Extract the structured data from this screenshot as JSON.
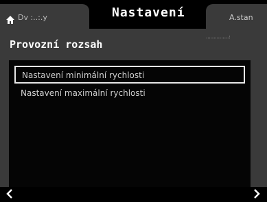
{
  "tabs": {
    "prev_label": "Dv  :..:.y",
    "title": "Nastavení",
    "next_label": "A.stan"
  },
  "section": {
    "title": "Provozní rozsah",
    "subtitle": "...............:"
  },
  "list": {
    "items": [
      {
        "label": "Nastavení minimální rychlosti"
      },
      {
        "label": "Nastavení maximální rychlosti"
      }
    ]
  },
  "icons": {
    "home": "home-icon",
    "left": "chevron-left-icon",
    "right": "chevron-right-icon"
  },
  "colors": {
    "background": "#000000",
    "panel": "#3a3a3a",
    "list": "#050505",
    "text": "#ffffff",
    "selection_border": "#e8e8e8"
  }
}
